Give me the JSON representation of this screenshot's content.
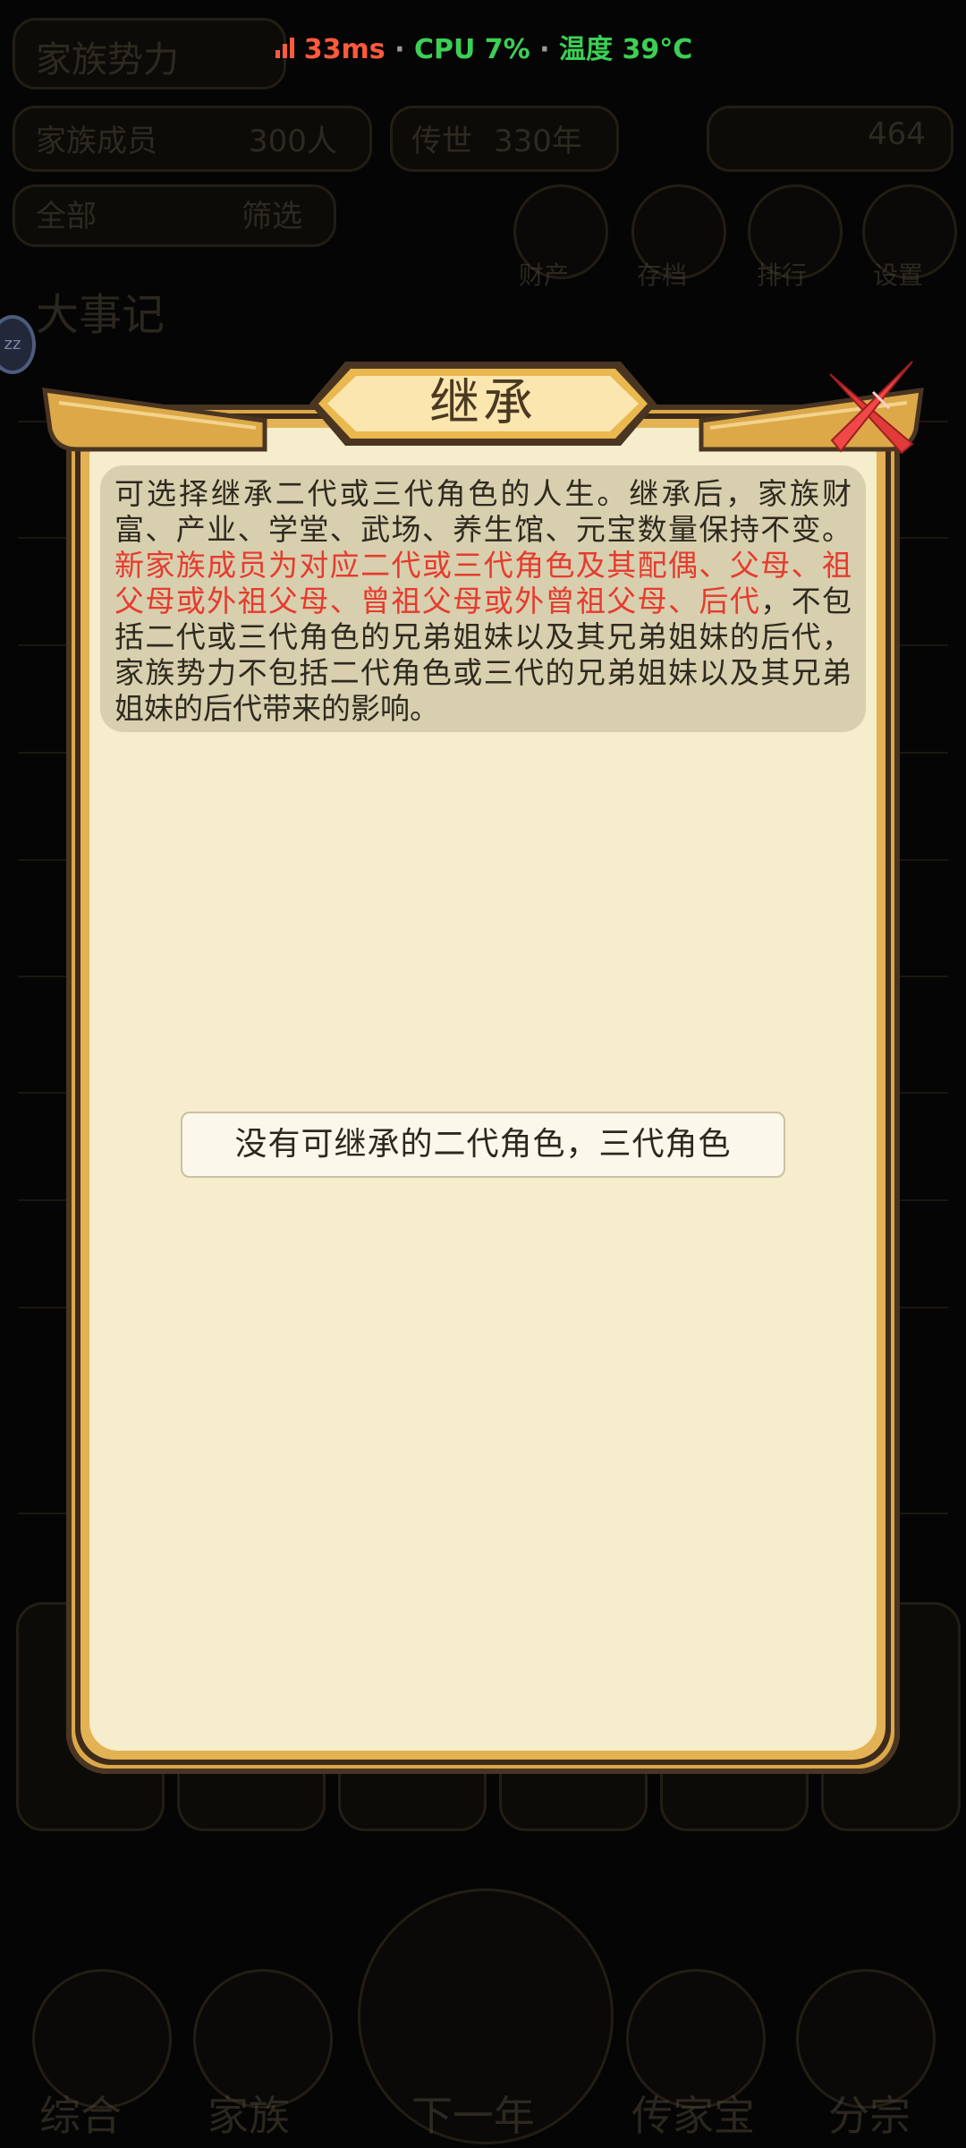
{
  "status_bar": {
    "ping": "33ms",
    "separator": " · ",
    "cpu": "CPU 7%",
    "temperature": "温度 39°C"
  },
  "background": {
    "header_title": "家族势力",
    "members_label": "家族成员",
    "members_value": "300人",
    "inherit_label": "传世",
    "inherit_value": "330年",
    "wealth_value": "464",
    "tab_1": "全部",
    "tab_2": "筛选",
    "action_1": "财产",
    "action_2": "存档",
    "action_3": "排行",
    "action_4": "设置",
    "section_title": "大事记",
    "nav_1": "综合",
    "nav_2": "家族",
    "nav_3": "下一年",
    "nav_4": "传家宝",
    "nav_5": "分宗"
  },
  "dialog": {
    "title": "继承",
    "intro_normal": "可选择继承二代或三代角色的人生。继承后，家族财富、产业、学堂、武场、养生馆、元宝数量保持不变。",
    "intro_highlight": "新家族成员为对应二代或三代角色及其配偶、父母、祖父母或外祖父母、曾祖父母或外曾祖父母、后代",
    "intro_tail": "，不包括二代或三代角色的兄弟姐妹以及其兄弟姐妹的后代，家族势力不包括二代角色或三代的兄弟姐妹以及其兄弟姐妹的后代带来的影响。",
    "empty_message": "没有可继承的二代角色，三代角色"
  },
  "colors": {
    "panel": "#f5edcc",
    "frame_gold": "#dca848",
    "highlight_red": "#e63b2e",
    "close_red": "#e13a3a"
  }
}
